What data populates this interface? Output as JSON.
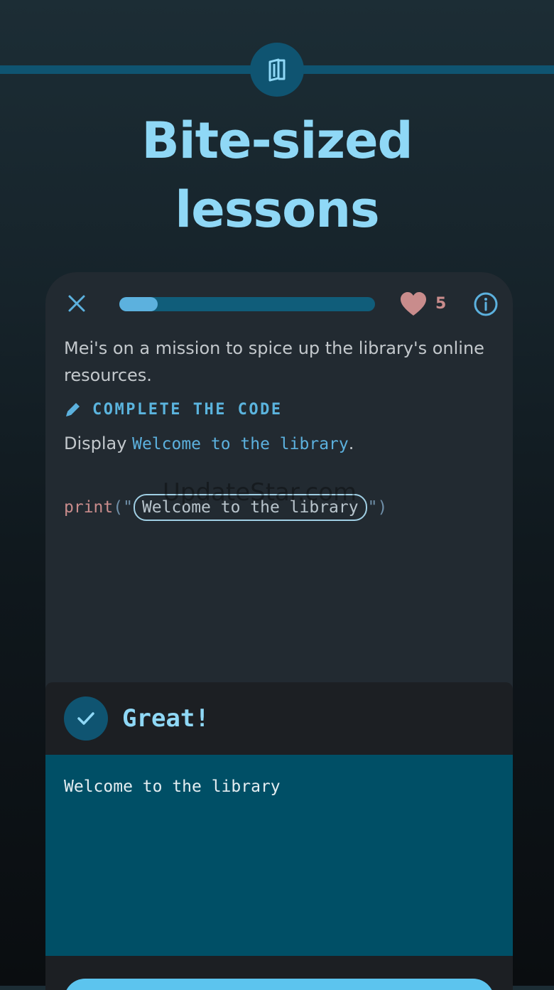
{
  "hero": {
    "icon": "book-icon",
    "headline_line1": "Bite-sized",
    "headline_line2": "lessons"
  },
  "lesson": {
    "close_icon": "close-icon",
    "progress": 0.15,
    "lives": "5",
    "lives_icon": "heart-icon",
    "info_icon": "info-icon",
    "narrative": "Mei's on a mission to spice up the library's online resources.",
    "section_icon": "pencil-icon",
    "section_label": "COMPLETE THE CODE",
    "instruction_prefix": "Display ",
    "instruction_code": "Welcome to the library",
    "instruction_suffix": ".",
    "code": {
      "function": "print",
      "open": "(\"",
      "slot": "Welcome to the library",
      "close": "\")"
    },
    "watermark": "UpdateStar.com"
  },
  "feedback": {
    "icon": "checkmark-icon",
    "title": "Great!",
    "output": "Welcome to the library"
  },
  "colors": {
    "accent": "#8fd8f6",
    "primary_blue": "#5cb1de",
    "dark_teal": "#0f5471",
    "output_bg": "#004f66",
    "card_bg": "#222a31",
    "heart": "#c98c8c"
  }
}
